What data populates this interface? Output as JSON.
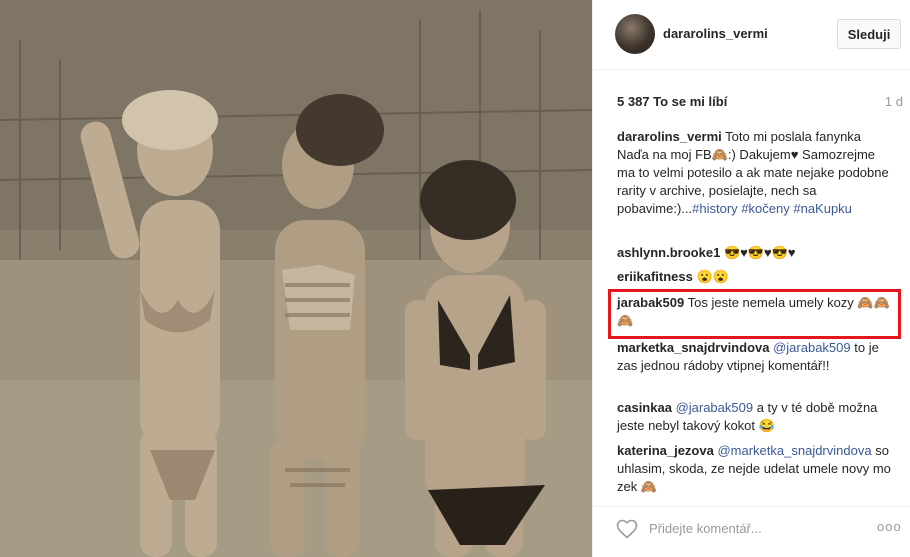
{
  "post": {
    "owner_username": "dararolins_vermi",
    "follow_label": "Sleduji",
    "likes_text": "5 387 To se mi líbí",
    "time_ago": "1 d"
  },
  "comments": [
    {
      "user": "dararolins_vermi",
      "text": "Toto mi poslala fanynka Naďa na moj FB🙈:) Dakujem♥ Samozrejme ma to velmi potesilo a ak mate nejake podobne rarity v archive, posielajte, nech sa pobavime:)...",
      "tags": [
        "#history",
        "#kočeny",
        "#naKupku"
      ]
    },
    {
      "user": "ashlynn.brooke1",
      "text": "😎♥😎♥😎♥"
    },
    {
      "user": "eriikafitness",
      "text": "😮😮"
    },
    {
      "user": "jarabak509",
      "text": "Tos jeste nemela umely kozy 🙈🙈🙈"
    },
    {
      "user": "marketka_snajdrvindova",
      "mention": "@jarabak509",
      "text": "to je zas jednou rádoby vtipnej komentář!!"
    },
    {
      "user": "casinkaa",
      "mention": "@jarabak509",
      "text": "a ty v té době možna jeste nebyl takový kokot 😂"
    },
    {
      "user": "katerina_jezova",
      "mention": "@marketka_snajdrvindova",
      "text": "souhlasim, skoda, ze nejde udelat umele novy mozek 🙈"
    }
  ],
  "footer": {
    "comment_placeholder": "Přidejte komentář...",
    "more_label": "ooo"
  },
  "icons": {
    "like": "heart-outline-icon",
    "more": "more-options-icon"
  },
  "colors": {
    "link": "#3b5998",
    "highlight": "#e3161c",
    "secondary_text": "#999999"
  }
}
